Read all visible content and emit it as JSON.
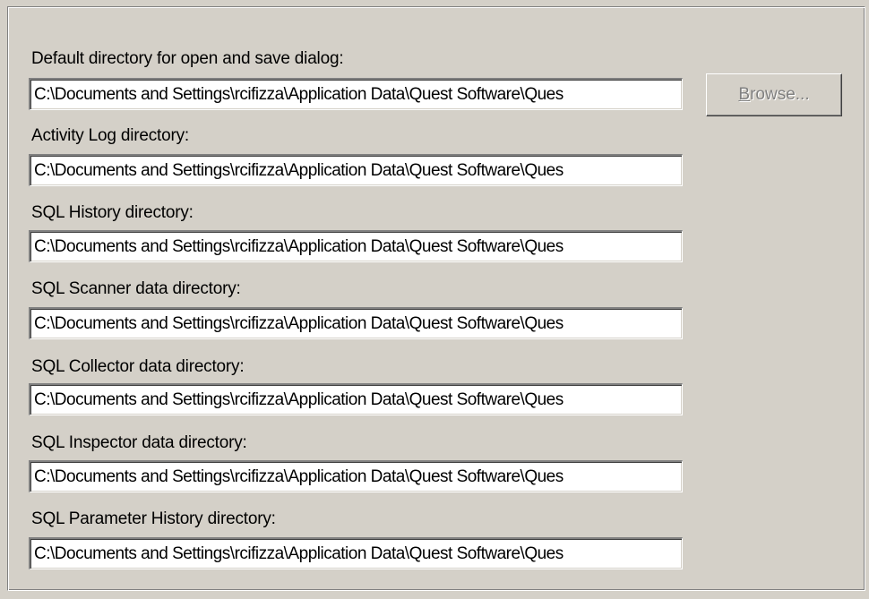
{
  "dialog": {
    "fields": [
      {
        "label": "Default directory for open and save dialog:",
        "value": "C:\\Documents and Settings\\rcifizza\\Application Data\\Quest Software\\Ques"
      },
      {
        "label": "Activity Log directory:",
        "value": "C:\\Documents and Settings\\rcifizza\\Application Data\\Quest Software\\Ques"
      },
      {
        "label": "SQL History directory:",
        "value": "C:\\Documents and Settings\\rcifizza\\Application Data\\Quest Software\\Ques"
      },
      {
        "label": "SQL Scanner data directory:",
        "value": "C:\\Documents and Settings\\rcifizza\\Application Data\\Quest Software\\Ques"
      },
      {
        "label": "SQL Collector data directory:",
        "value": "C:\\Documents and Settings\\rcifizza\\Application Data\\Quest Software\\Ques"
      },
      {
        "label": "SQL Inspector data directory:",
        "value": "C:\\Documents and Settings\\rcifizza\\Application Data\\Quest Software\\Ques"
      },
      {
        "label": "SQL Parameter History directory:",
        "value": "C:\\Documents and Settings\\rcifizza\\Application Data\\Quest Software\\Ques"
      }
    ],
    "browse_button": {
      "label": "Browse...",
      "enabled": false
    }
  }
}
